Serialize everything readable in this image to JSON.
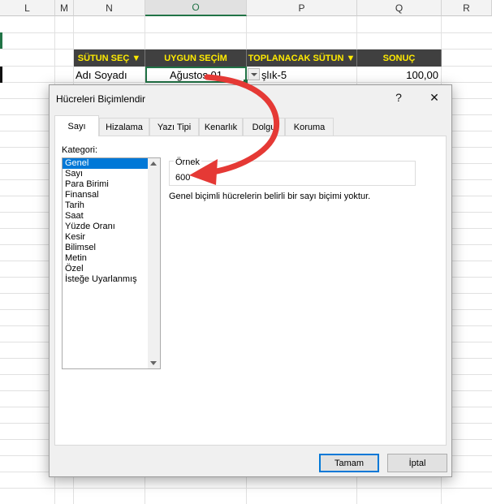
{
  "spreadsheet": {
    "columns": [
      "L",
      "M",
      "N",
      "O",
      "P",
      "Q",
      "R"
    ],
    "active_column": "O",
    "table_headers": [
      "SÜTUN SEÇ ▼",
      "UYGUN SEÇİM",
      "TOPLANACAK SÜTUN ▼",
      "SONUÇ"
    ],
    "row": {
      "name": "Adı Soyadı",
      "choice": "Ağustos 01",
      "sum_column": "şlık-5",
      "result": "100,00"
    },
    "colors": {
      "header_bg": "#404040",
      "header_text": "#ffeb00",
      "accent": "#217346"
    }
  },
  "dialog": {
    "title": "Hücreleri Biçimlendir",
    "help_label": "?",
    "close_label": "✕",
    "tabs": [
      "Sayı",
      "Hizalama",
      "Yazı Tipi",
      "Kenarlık",
      "Dolgu",
      "Koruma"
    ],
    "selected_tab": "Sayı",
    "category_label": "Kategori:",
    "categories": [
      "Genel",
      "Sayı",
      "Para Birimi",
      "Finansal",
      "Tarih",
      "Saat",
      "Yüzde Oranı",
      "Kesir",
      "Bilimsel",
      "Metin",
      "Özel",
      "İsteğe Uyarlanmış"
    ],
    "selected_category": "Genel",
    "sample_label": "Örnek",
    "sample_value": "600",
    "description": "Genel biçimli hücrelerin belirli bir sayı biçimi yoktur.",
    "ok_label": "Tamam",
    "cancel_label": "İptal"
  },
  "annotation": {
    "arrow_color": "#e53935"
  }
}
